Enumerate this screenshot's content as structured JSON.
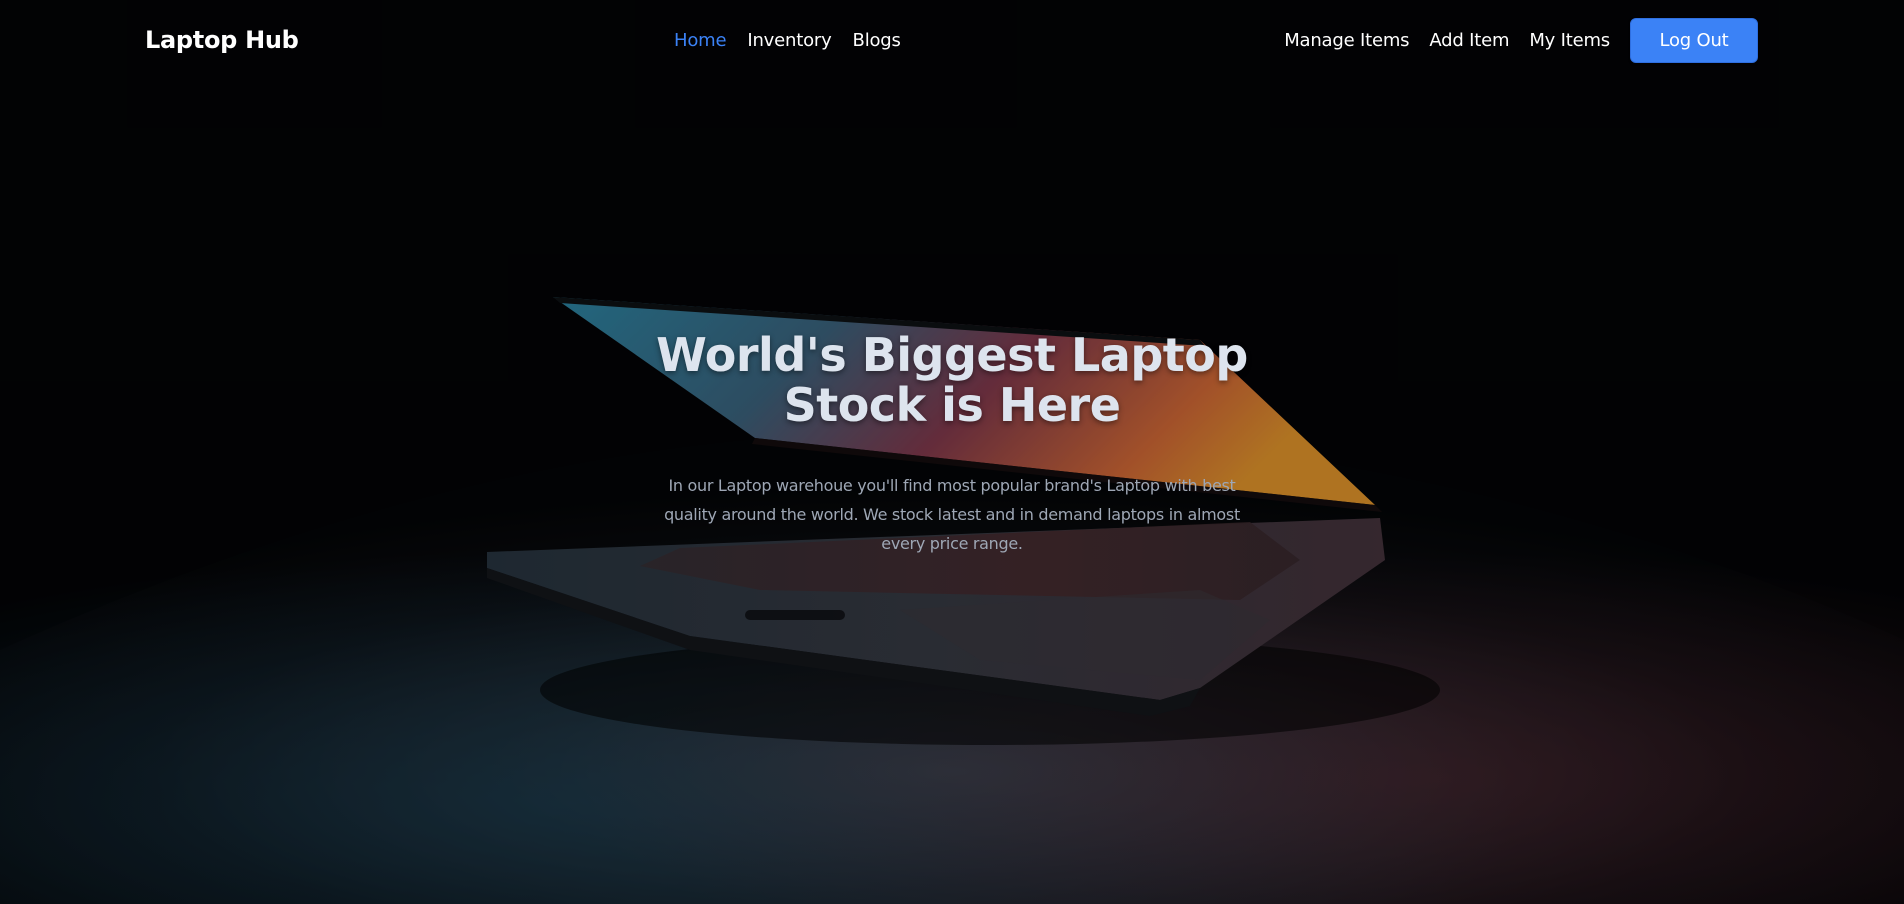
{
  "navbar": {
    "brand": "Laptop Hub",
    "center_links": [
      {
        "label": "Home",
        "active": true
      },
      {
        "label": "Inventory",
        "active": false
      },
      {
        "label": "Blogs",
        "active": false
      }
    ],
    "right_links": [
      {
        "label": "Manage Items"
      },
      {
        "label": "Add Item"
      },
      {
        "label": "My Items"
      }
    ],
    "logout_label": "Log Out"
  },
  "hero": {
    "title": "World's Biggest Laptop Stock is Here",
    "description": "In our Laptop warehoue you'll find most popular brand's Laptop with best quality around the world. We stock latest and in demand laptops in almost every price range."
  },
  "colors": {
    "accent": "#3b82f6",
    "background": "#030406",
    "text_primary": "#ffffff",
    "hero_title": "#dde4ee",
    "hero_text": "#9ea7b5"
  }
}
